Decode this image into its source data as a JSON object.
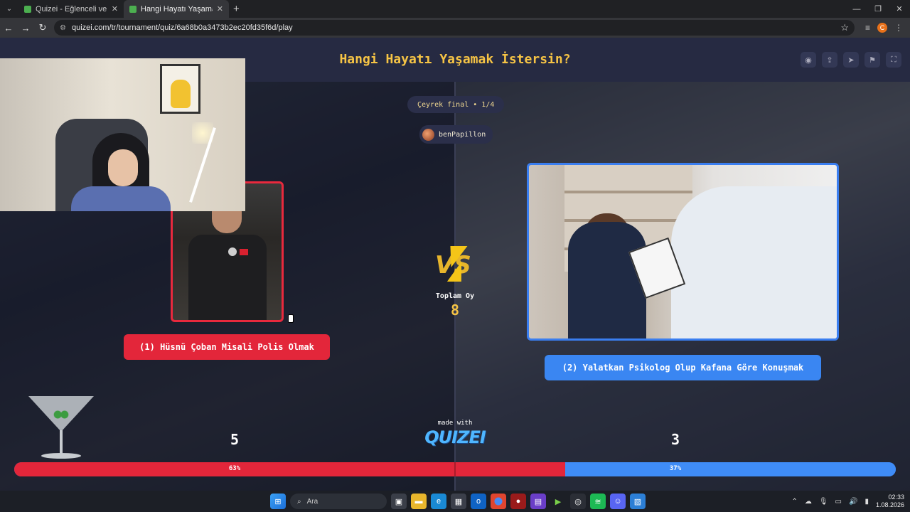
{
  "browser": {
    "tabs": [
      {
        "title": "Quizei - Eğlenceli ve etkileşimli",
        "active": false
      },
      {
        "title": "Hangi Hayatı Yaşamak İstersin?",
        "active": true
      }
    ],
    "url": "quizei.com/tr/tournament/quiz/6a68b0a3473b2ec20fd35f6d/play",
    "profile_initial": "C"
  },
  "header": {
    "title": "Hangi Hayatı Yaşamak İstersin?"
  },
  "round": {
    "label": "Çeyrek final • 1/4"
  },
  "user": {
    "name": "benPapillon"
  },
  "options": [
    {
      "label": "(1) Hüsnü Çoban Misali Polis Olmak",
      "votes": "5",
      "percent": "63%",
      "color": "#e3263a"
    },
    {
      "label": "(2) Yalatkan Psikolog Olup Kafana Göre Konuşmak",
      "votes": "3",
      "percent": "37%",
      "color": "#3a86f2"
    }
  ],
  "vs": {
    "text": "VS",
    "total_label": "Toplam Oy",
    "total_value": "8"
  },
  "branding": {
    "made_with": "made with",
    "brand": "QUIZEI"
  },
  "vote_share": {
    "left_fraction": 0.625,
    "right_fraction": 0.375
  },
  "taskbar": {
    "search_placeholder": "Ara",
    "time": "02:33",
    "date": "1.08.2026"
  }
}
